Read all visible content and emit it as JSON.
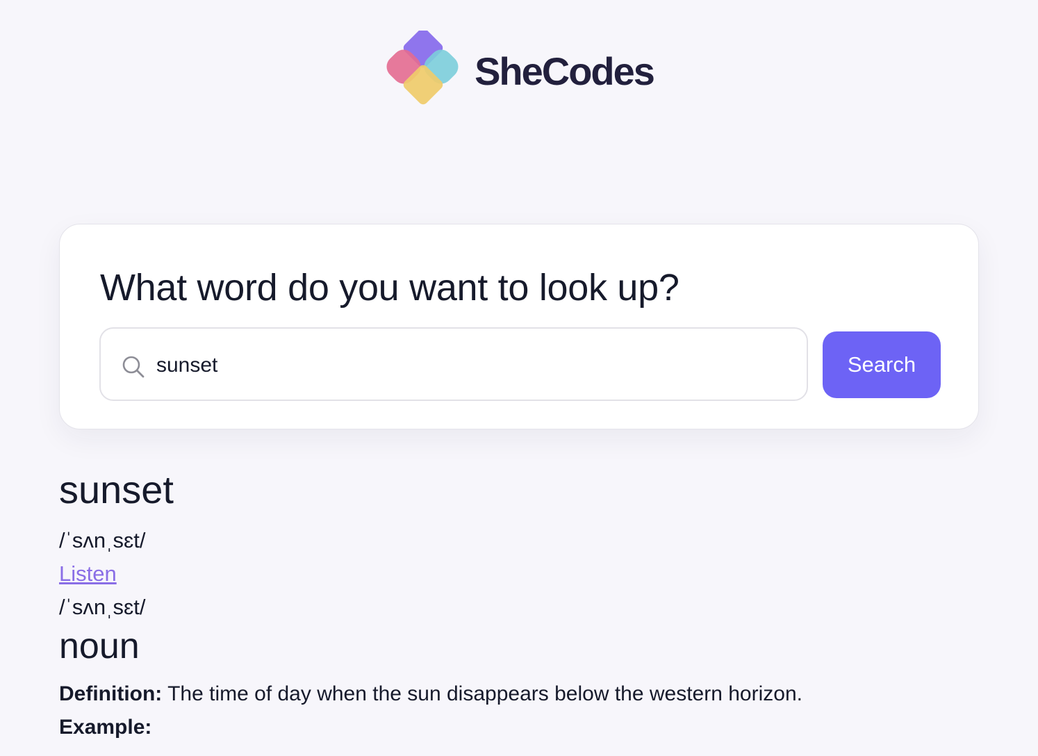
{
  "brand": {
    "name": "SheCodes",
    "colors": {
      "purple": "#8b6ef0",
      "pink": "#ec6f93",
      "cyan": "#7fd6df",
      "yellow": "#f7d46c",
      "text": "#22203d"
    }
  },
  "search": {
    "heading": "What word do you want to look up?",
    "value": "sunset",
    "button_label": "Search",
    "icon": "search-icon",
    "accent": "#6d63f5"
  },
  "result": {
    "word": "sunset",
    "phonetic_1": "/ˈsʌnˌsɛt/",
    "listen_label": "Listen",
    "phonetic_2": "/ˈsʌnˌsɛt/",
    "part_of_speech": "noun",
    "definition_label": "Definition:",
    "definition": " The time of day when the sun disappears below the western horizon.",
    "example_label": "Example:"
  }
}
